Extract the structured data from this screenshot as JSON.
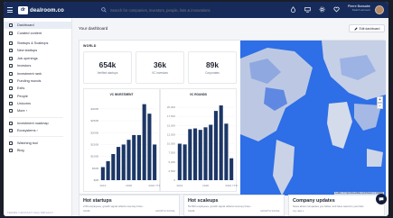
{
  "topbar": {
    "brand": "dealroom.co",
    "logo_mark": "dr",
    "search_placeholder": "Search for companies, investors, people, lists & innovations",
    "user_name": "Pierre Bonsabe",
    "user_role": "Switch account",
    "icons": [
      "droplet-icon",
      "monitor-icon",
      "gear-icon",
      "heart-icon"
    ]
  },
  "sidebar": {
    "items": [
      {
        "label": "Dashboard",
        "active": true
      },
      {
        "label": "Curated content"
      },
      {
        "label": "Startups & Scaleups"
      },
      {
        "label": "New startups"
      },
      {
        "label": "Job openings"
      },
      {
        "label": "Investors"
      },
      {
        "label": "Investment rank"
      },
      {
        "label": "Funding rounds"
      },
      {
        "label": "Exits"
      },
      {
        "label": "People"
      },
      {
        "label": "Unicorns"
      },
      {
        "label": "More ›"
      },
      {
        "label": "Investment roadmap"
      },
      {
        "label": "Ecosystems ›"
      },
      {
        "label": "Watching tool"
      },
      {
        "label": "Blog"
      }
    ],
    "footer": "TERMS  CONTACT  FAQ  PRIVACY"
  },
  "main": {
    "title": "Your dashboard",
    "edit_button": "Edit dashboard",
    "world": {
      "label": "WORLD",
      "kpis": [
        {
          "value": "654k",
          "label": "Verified startups"
        },
        {
          "value": "36k",
          "label": "VC investors"
        },
        {
          "value": "89k",
          "label": "Corporates"
        }
      ]
    },
    "map_attribution": "Leaflet | © OpenStreetMap contributors © CARTO"
  },
  "chart_data": [
    {
      "type": "bar",
      "title": "VC INVESTMENT",
      "categories": [
        "2013",
        "2014",
        "2015",
        "2016",
        "2017",
        "2018",
        "2019",
        "2020",
        "2021",
        "2022",
        "2023 YTD"
      ],
      "values": [
        55,
        80,
        110,
        140,
        150,
        170,
        190,
        190,
        320,
        280,
        150
      ],
      "yticks": [
        "$0B",
        "$50B",
        "$100B",
        "$150B",
        "$200B",
        "$250B",
        "$300B"
      ],
      "xticks": [
        "2013",
        "2018",
        "2023 YTD"
      ],
      "ylim": [
        0,
        330
      ],
      "color": "#1c3766"
    },
    {
      "type": "bar",
      "title": "VC ROUNDS",
      "categories": [
        "2013",
        "2014",
        "2015",
        "2016",
        "2017",
        "2018",
        "2019",
        "2020",
        "2021",
        "2022",
        "2023 YTD"
      ],
      "values": [
        10000,
        9800,
        14000,
        14200,
        13800,
        14500,
        15200,
        19000,
        20500,
        15500,
        6000
      ],
      "yticks": [
        "0",
        "2,500",
        "5,000",
        "7,500",
        "10,000",
        "12,500",
        "15,000",
        "17,500",
        "20,000"
      ],
      "xticks": [
        "2013",
        "2018",
        "2023 YTD"
      ],
      "ylim": [
        0,
        21500
      ],
      "color": "#1c3766"
    }
  ],
  "cards": [
    {
      "title": "Hot startups",
      "subtitle": "2-50 employees, growth signal reflects new key hires...",
      "col1": "NAME",
      "col2": "GROWTH SIGNAL"
    },
    {
      "title": "Hot scaleups",
      "subtitle": "51-500 employees, growth signal reflects new key hires...",
      "col1": "NAME",
      "col2": "GROWTH SIGNAL"
    },
    {
      "title": "Company updates",
      "subtitle": "News about companies you follow, and have saved to your lists",
      "col1": "Any date ▾",
      "col2": ""
    }
  ]
}
